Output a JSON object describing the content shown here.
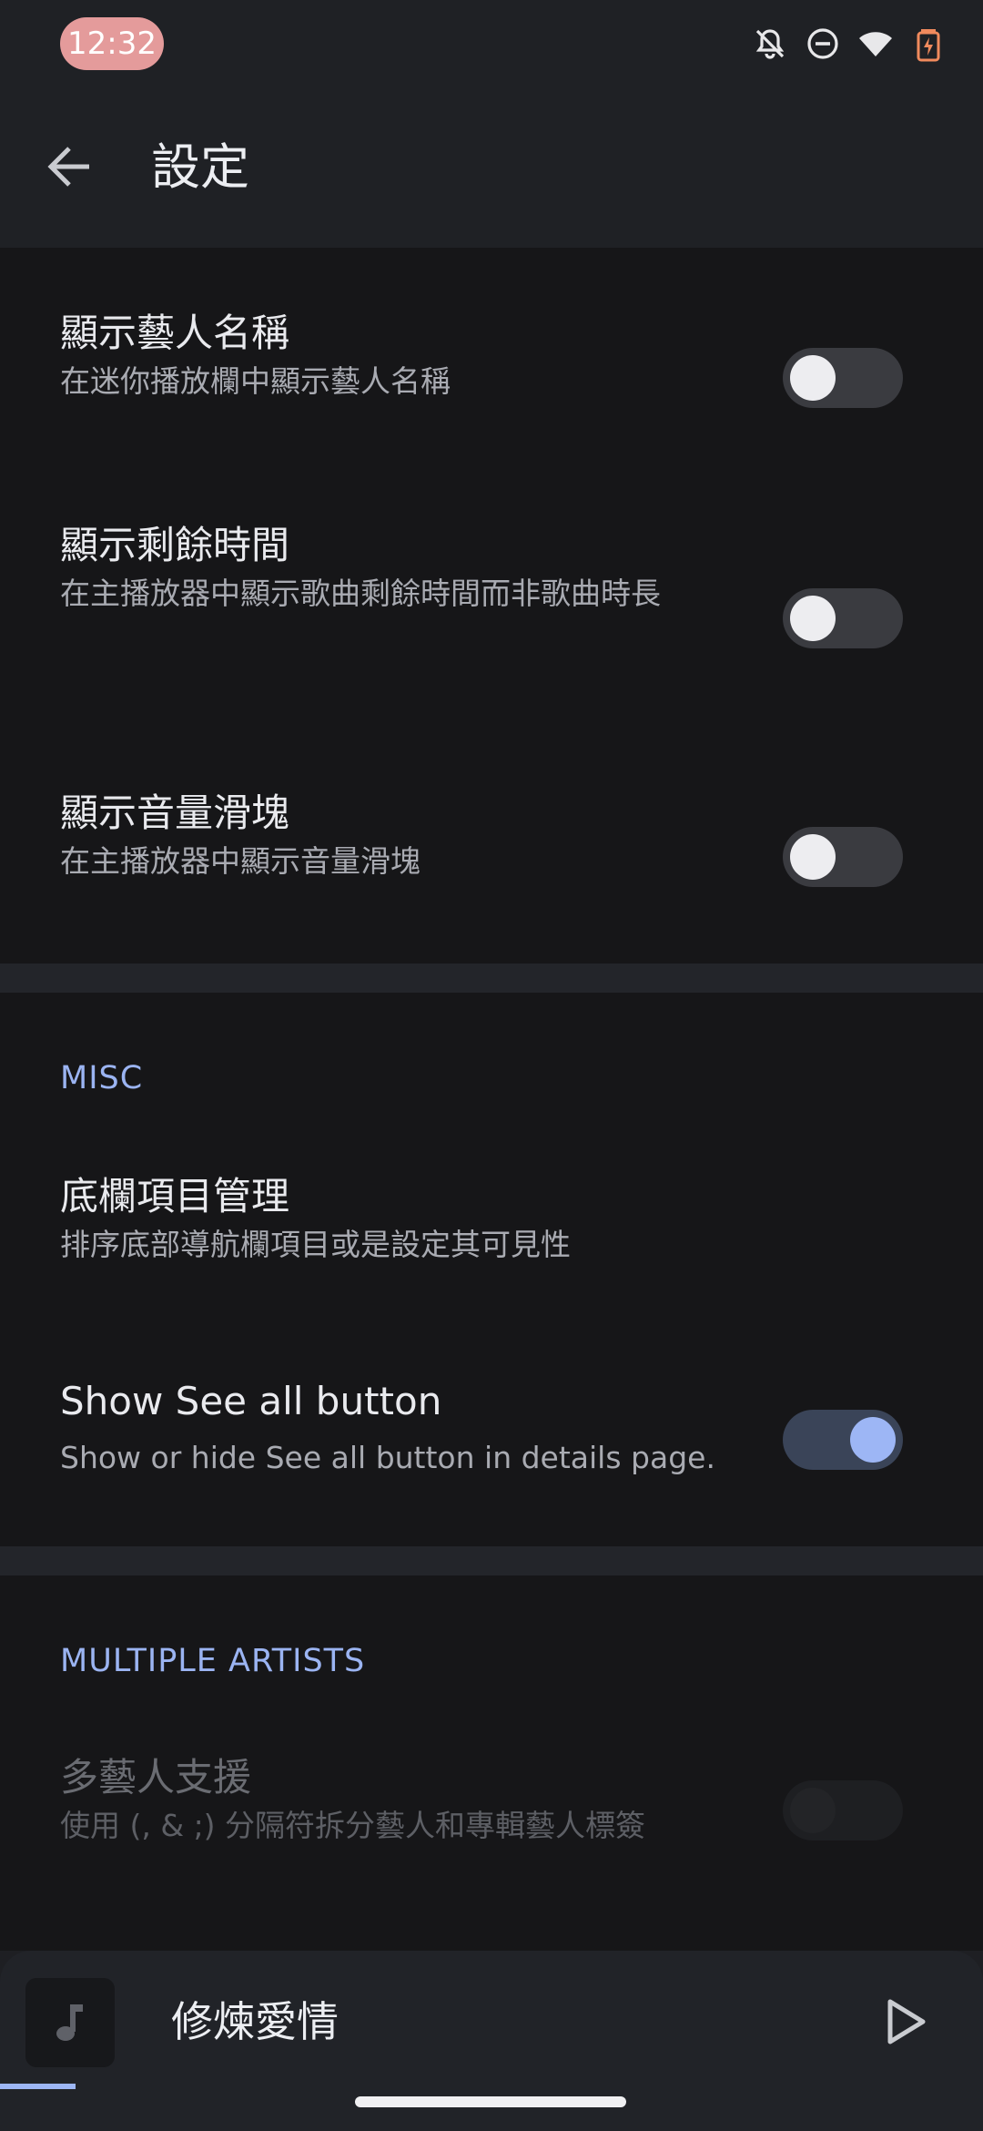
{
  "status_bar": {
    "time": "12:32",
    "icons": [
      "notifications-off-icon",
      "do-not-disturb-icon",
      "wifi-icon",
      "battery-charging-icon"
    ]
  },
  "app_bar": {
    "title": "設定",
    "back_icon": "back-arrow-icon"
  },
  "settings": [
    {
      "title": "顯示藝人名稱",
      "subtitle": "在迷你播放欄中顯示藝人名稱",
      "enabled": false
    },
    {
      "title": "顯示剩餘時間",
      "subtitle": "在主播放器中顯示歌曲剩餘時間而非歌曲時長",
      "enabled": false
    },
    {
      "title": "顯示音量滑塊",
      "subtitle": "在主播放器中顯示音量滑塊",
      "enabled": false
    }
  ],
  "misc": {
    "header": "MISC",
    "nav_manager": {
      "title": "底欄項目管理",
      "subtitle": "排序底部導航欄項目或是設定其可見性"
    },
    "see_all": {
      "title": "Show See all button",
      "subtitle": "Show or hide See all button in details page.",
      "enabled": true
    }
  },
  "multiple_artists": {
    "header": "MULTIPLE ARTISTS",
    "support": {
      "title": "多藝人支援",
      "subtitle": "使用 (, & ;) 分隔符拆分藝人和專輯藝人標簽",
      "enabled": false,
      "disabled": true
    }
  },
  "mini_player": {
    "song_title": "修煉愛情",
    "progress": 0.077
  },
  "colors": {
    "accent": "#9db6f5",
    "background": "#161618",
    "time_pill": "#e49b9b",
    "battery": "#f08a5d"
  }
}
